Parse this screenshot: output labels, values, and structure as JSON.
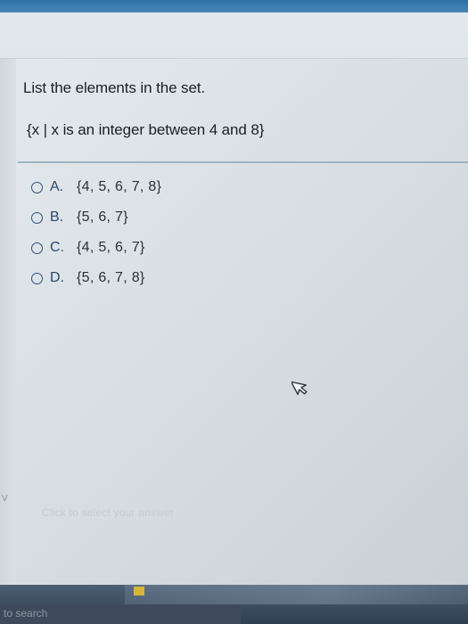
{
  "question": {
    "prompt": "List the elements in the set.",
    "set_expression": "{x | x is an integer between 4 and 8}",
    "options": [
      {
        "letter": "A.",
        "value": "{4, 5, 6, 7, 8}"
      },
      {
        "letter": "B.",
        "value": "{5, 6, 7}"
      },
      {
        "letter": "C.",
        "value": "{4, 5, 6, 7}"
      },
      {
        "letter": "D.",
        "value": "{5, 6, 7, 8}"
      }
    ]
  },
  "footer": {
    "hint": "Click to select your answer",
    "side_mark": "V"
  },
  "taskbar": {
    "search_text": "to search"
  },
  "colors": {
    "accent": "#2f6fa3",
    "radio_outline": "#2e4f7d",
    "divider": "#9fb4c2"
  }
}
